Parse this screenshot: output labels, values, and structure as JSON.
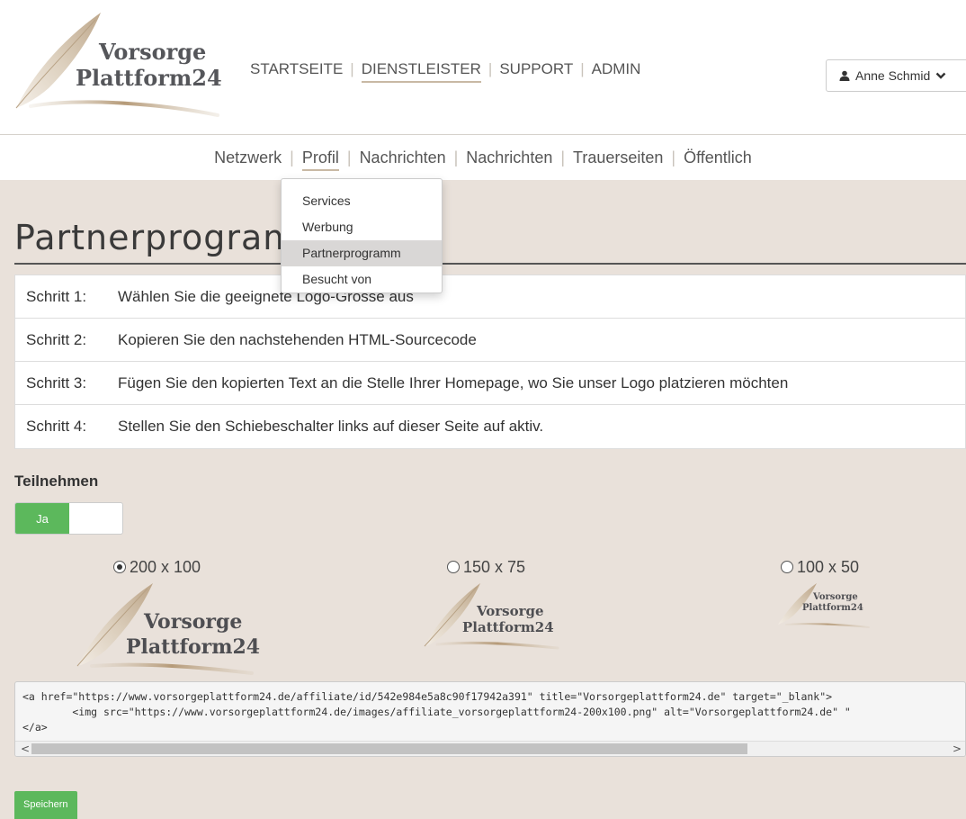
{
  "brand": {
    "line1": "Vorsorge",
    "line2": "Plattform24"
  },
  "main_nav": {
    "items": [
      {
        "label": "STARTSEITE",
        "active": false
      },
      {
        "label": "DIENSTLEISTER",
        "active": true
      },
      {
        "label": "SUPPORT",
        "active": false
      },
      {
        "label": "ADMIN",
        "active": false
      }
    ],
    "separator": "|"
  },
  "user_menu": {
    "label": "Anne Schmid",
    "icon": "user-icon",
    "chevron": "chevron-down-icon"
  },
  "sub_nav": {
    "items": [
      {
        "label": "Netzwerk",
        "active": false
      },
      {
        "label": "Profil",
        "active": true
      },
      {
        "label": "Nachrichten",
        "active": false
      },
      {
        "label": "Nachrichten",
        "active": false
      },
      {
        "label": "Trauerseiten",
        "active": false
      },
      {
        "label": "Öffentlich",
        "active": false
      }
    ],
    "separator": "|"
  },
  "profile_dropdown": {
    "items": [
      {
        "label": "Services",
        "hover": false
      },
      {
        "label": "Werbung",
        "hover": false
      },
      {
        "label": "Partnerprogramm",
        "hover": true
      },
      {
        "label": "Besucht von",
        "hover": false
      }
    ]
  },
  "page": {
    "title": "Partnerprogramm",
    "steps": [
      {
        "num": "Schritt 1:",
        "text": "Wählen Sie die geeignete Logo-Grosse aus"
      },
      {
        "num": "Schritt 2:",
        "text": "Kopieren Sie den nachstehenden HTML-Sourcecode"
      },
      {
        "num": "Schritt 3:",
        "text": "Fügen Sie den kopierten Text an die Stelle Ihrer Homepage, wo Sie unser Logo platzieren möchten"
      },
      {
        "num": "Schritt 4:",
        "text": "Stellen Sie den Schiebeschalter links auf dieser Seite auf aktiv."
      }
    ],
    "participate_label": "Teilnehmen",
    "toggle": {
      "on_label": "Ja",
      "state": "on"
    },
    "sizes": [
      {
        "label": "200 x 100",
        "checked": true,
        "logo_line1": "Vorsorge",
        "logo_line2": "Plattform24"
      },
      {
        "label": "150 x 75",
        "checked": false,
        "logo_line1": "Vorsorge",
        "logo_line2": "Plattform24"
      },
      {
        "label": "100 x 50",
        "checked": false,
        "logo_line1": "Vorsorge",
        "logo_line2": "Plattform24"
      }
    ],
    "code_lines": [
      "<a href=\"https://www.vorsorgeplattform24.de/affiliate/id/542e984e5a8c90f17942a391\" title=\"Vorsorgeplattform24.de\" target=\"_blank\">",
      "        <img src=\"https://www.vorsorgeplattform24.de/images/affiliate_vorsorgeplattform24-200x100.png\" alt=\"Vorsorgeplattform24.de\" \"",
      "</a>"
    ],
    "scroll": {
      "left_arrow": "<",
      "right_arrow": ">"
    },
    "save_label": "Speichern"
  },
  "colors": {
    "content_bg": "#e9e1da",
    "accent_green": "#5cb85c",
    "nav_underline": "#c8b9a4",
    "logo_text": "#55565a"
  }
}
